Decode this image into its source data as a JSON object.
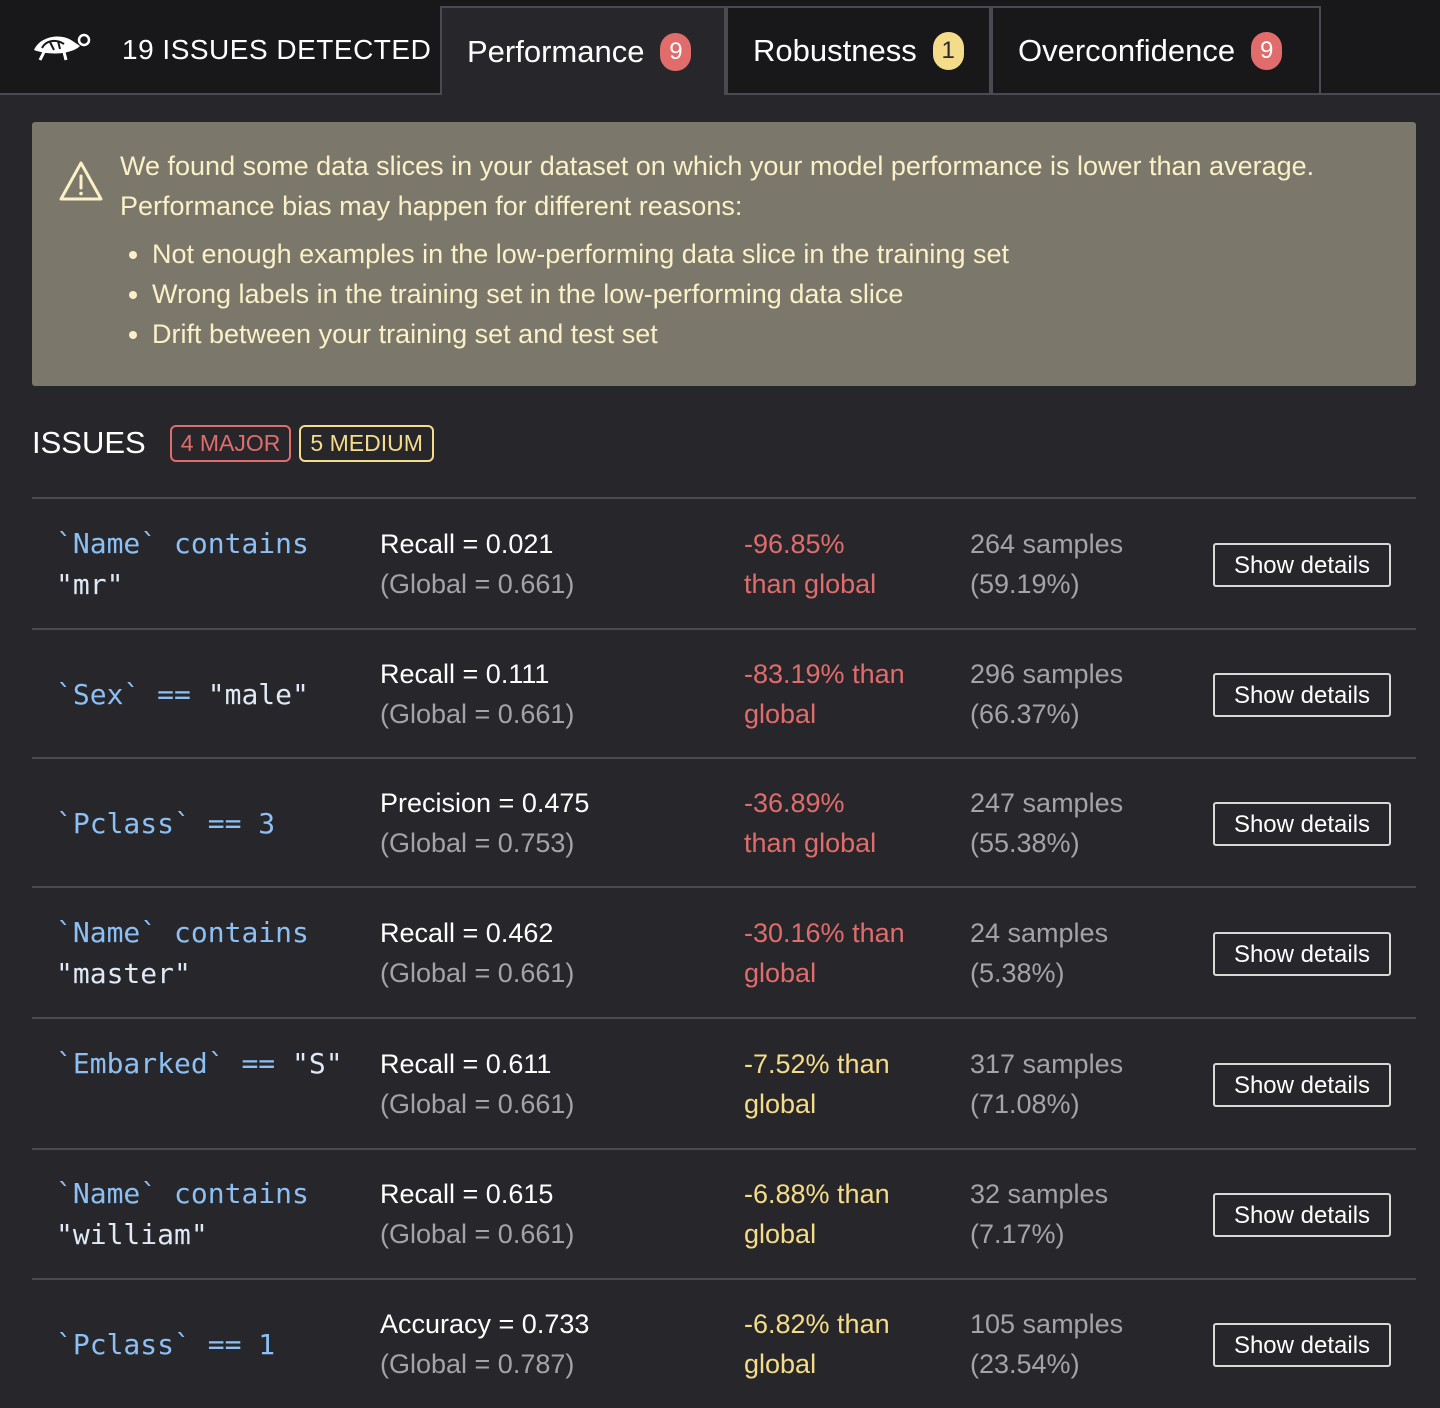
{
  "header": {
    "issues_detected": "19 ISSUES DETECTED",
    "tabs": [
      {
        "label": "Performance",
        "badge": "9",
        "badge_color": "#e06c6c",
        "active": true
      },
      {
        "label": "Robustness",
        "badge": "1",
        "badge_color": "#f5dc8a",
        "active": false
      },
      {
        "label": "Overconfidence",
        "badge": "9",
        "badge_color": "#e06c6c",
        "active": false
      }
    ]
  },
  "alert": {
    "icon": "warning-triangle-icon",
    "intro": "We found some data slices in your dataset on which your model performance is lower than average. Performance bias may happen for different reasons:",
    "reasons": [
      "Not enough examples in the low-performing data slice in the training set",
      "Wrong labels in the training set in the low-performing data slice",
      "Drift between your training set and test set"
    ]
  },
  "issues": {
    "title": "ISSUES",
    "major": "4 MAJOR",
    "medium": "5 MEDIUM",
    "button_label": "Show details",
    "rows": [
      {
        "slice": "`Name` contains \"mr\"",
        "metric": "Recall = 0.021",
        "global": "(Global = 0.661)",
        "delta": "-96.85% than global",
        "severity": "major",
        "samples": "264 samples (59.19%)"
      },
      {
        "slice": "`Sex` == \"male\"",
        "metric": "Recall = 0.111",
        "global": "(Global = 0.661)",
        "delta": "-83.19% than global",
        "severity": "major",
        "samples": "296 samples (66.37%)"
      },
      {
        "slice": "`Pclass` == 3",
        "metric": "Precision = 0.475",
        "global": "(Global = 0.753)",
        "delta": "-36.89% than global",
        "severity": "major",
        "samples": "247 samples (55.38%)"
      },
      {
        "slice": "`Name` contains \"master\"",
        "metric": "Recall = 0.462",
        "global": "(Global = 0.661)",
        "delta": "-30.16% than global",
        "severity": "major",
        "samples": "24 samples (5.38%)"
      },
      {
        "slice": "`Embarked` == \"S\"",
        "metric": "Recall = 0.611",
        "global": "(Global = 0.661)",
        "delta": "-7.52% than global",
        "severity": "medium",
        "samples": "317 samples (71.08%)"
      },
      {
        "slice": "`Name` contains \"william\"",
        "metric": "Recall = 0.615",
        "global": "(Global = 0.661)",
        "delta": "-6.88% than global",
        "severity": "medium",
        "samples": "32 samples (7.17%)"
      },
      {
        "slice": "`Pclass` == 1",
        "metric": "Accuracy = 0.733",
        "global": "(Global = 0.787)",
        "delta": "-6.82% than global",
        "severity": "medium",
        "samples": "105 samples (23.54%)"
      }
    ]
  }
}
